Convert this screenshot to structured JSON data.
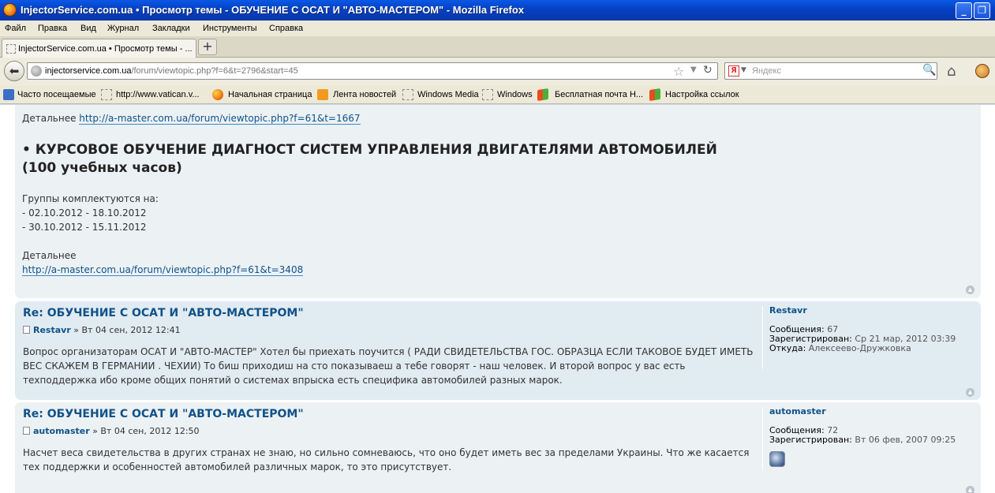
{
  "window": {
    "title": "InjectorService.com.ua • Просмотр темы - ОБУЧЕНИЕ С ОСАТ И \"АВТО-МАСТЕРОМ\" - Mozilla Firefox"
  },
  "menu": [
    "Файл",
    "Правка",
    "Вид",
    "Журнал",
    "Закладки",
    "Инструменты",
    "Справка"
  ],
  "tab": {
    "label": "InjectorService.com.ua • Просмотр темы - ..."
  },
  "nav": {
    "url_host": "injectorservice.com.ua",
    "url_path": "/forum/viewtopic.php?f=6&t=2796&start=45",
    "search_placeholder": "Яндекс",
    "search_engine_letter": "Я"
  },
  "bookmarks": [
    "Часто посещаемые",
    "http://www.vatican.v...",
    "Начальная страница",
    "Лента новостей",
    "Windows Media",
    "Windows",
    "Бесплатная почта Н...",
    "Настройка ссылок"
  ],
  "post1": {
    "detail1_label": "Детальнее",
    "detail1_link": "http://a-master.com.ua/forum/viewtopic.php?f=61&t=1667",
    "heading_line1": "• КУРСОВОЕ ОБУЧЕНИЕ ДИАГНОСТ СИСТЕМ УПРАВЛЕНИЯ ДВИГАТЕЛЯМИ АВТОМОБИЛЕЙ",
    "heading_line2": "(100 учебных часов)",
    "groups_label": "Группы комплектуются на:",
    "group1": "- 02.10.2012 - 18.10.2012",
    "group2": "- 30.10.2012 - 15.11.2012",
    "detail2_label": "Детальнее",
    "detail2_link": "http://a-master.com.ua/forum/viewtopic.php?f=61&t=3408"
  },
  "post2": {
    "title": "Re: ОБУЧЕНИЕ С ОСАТ И \"АВТО-МАСТЕРОМ\"",
    "author": "Restavr",
    "date": "» Вт 04 сен, 2012 12:41",
    "body": "Вопрос организаторам ОСАТ И \"АВТО-МАСТЕР\" Хотел бы приехать поучится ( РАДИ СВИДЕТЕЛЬСТВА ГОС. ОБРАЗЦА ЕСЛИ ТАКОВОЕ БУДЕТ ИМЕТЬ ВЕС СКАЖЕМ В ГЕРМАНИИ . ЧЕХИИ) То биш приходиш на сто показываеш а тебе говорят - наш человек. И второй вопрос у вас есть техподдержка ибо кроме общих понятий о системах впрыска есть специфика автомобилей разных марок.",
    "profile": {
      "name": "Restavr",
      "messages_label": "Сообщения:",
      "messages": "67",
      "registered_label": "Зарегистрирован:",
      "registered": "Ср 21 мар, 2012 03:39",
      "from_label": "Откуда:",
      "from": "Алексеево-Дружковка"
    }
  },
  "post3": {
    "title": "Re: ОБУЧЕНИЕ С ОСАТ И \"АВТО-МАСТЕРОМ\"",
    "author": "automaster",
    "date": "» Вт 04 сен, 2012 12:50",
    "body": "Насчет веса свидетельства в других странах не знаю, но сильно сомневаюсь, что оно будет иметь вес за пределами Украины. Что же касается тех поддержки и особенностей автомобилей различных марок, то это присутствует.",
    "profile": {
      "name": "automaster",
      "messages_label": "Сообщения:",
      "messages": "72",
      "registered_label": "Зарегистрирован:",
      "registered": "Вт 06 фев, 2007 09:25"
    }
  }
}
